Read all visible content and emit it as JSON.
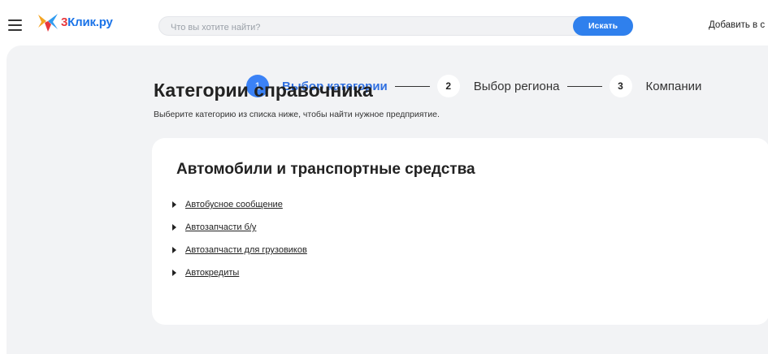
{
  "header": {
    "logo_text_3": "3",
    "logo_text_rest": "Клик.ру",
    "search_placeholder": "Что вы хотите найти?",
    "search_button": "Искать",
    "add_link": "Добавить в с"
  },
  "steps": [
    {
      "number": "1",
      "label": "Выбор категории",
      "active": true
    },
    {
      "number": "2",
      "label": "Выбор региона",
      "active": false
    },
    {
      "number": "3",
      "label": "Компании",
      "active": false
    }
  ],
  "page": {
    "title": "Категории справочника",
    "subtitle": "Выберите категорию из списка ниже, чтобы найти нужное предприятие."
  },
  "category_card": {
    "title": "Автомобили и транспортные средства",
    "items": [
      "Автобусное сообщение",
      "Автозапчасти б/у",
      "Автозапчасти для грузовиков",
      "Автокредиты"
    ]
  },
  "colors": {
    "accent": "#2f80ed",
    "background": "#f2f3f5",
    "logo_red": "#e8383d",
    "logo_blue": "#1a73e8"
  }
}
